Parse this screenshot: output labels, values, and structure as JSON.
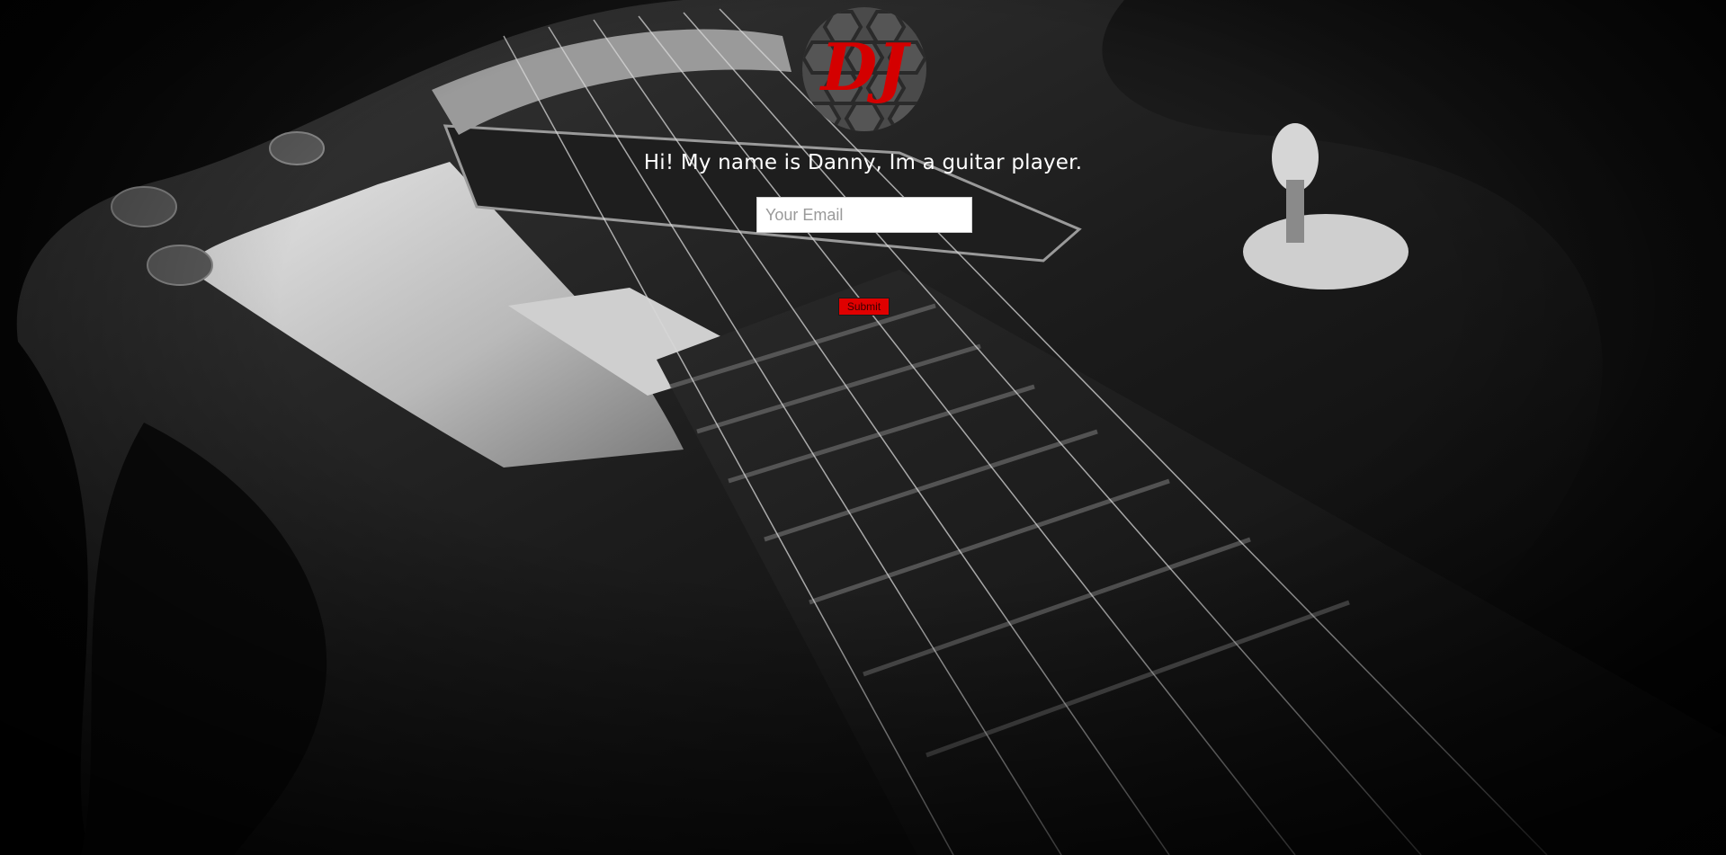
{
  "hero": {
    "logo_text": "DJ",
    "headline": "Hi! My name is Danny, Im a guitar player."
  },
  "form": {
    "email_placeholder": "Your Email",
    "email_value": "",
    "submit_label": "Submit"
  },
  "colors": {
    "accent": "#e00000",
    "logo_red": "#d40000",
    "background": "#050505",
    "text": "#ffffff"
  },
  "icons": {
    "logo": "dj-hex-logo-icon"
  }
}
